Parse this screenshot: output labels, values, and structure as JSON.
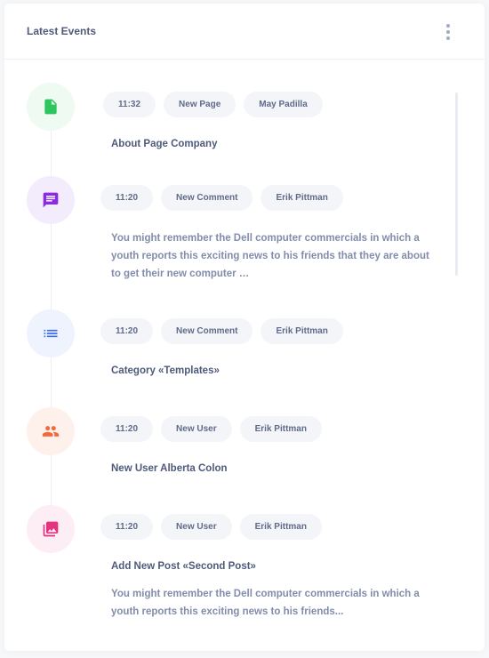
{
  "header": {
    "title": "Latest Events"
  },
  "events": [
    {
      "time": "11:32",
      "type": "New Page",
      "user": "May Padilla",
      "title": "About Page Company",
      "icon": "document-icon",
      "icon_color": "#2ec55c",
      "icon_bg": "#eefaf2"
    },
    {
      "time": "11:20",
      "type": "New Comment",
      "user": "Erik Pittman",
      "description": "You might remember the Dell computer commercials in which a youth reports this exciting news to his friends that they are about to get their new computer …",
      "icon": "comment-icon",
      "icon_color": "#8a2be2",
      "icon_bg": "#f3ecfd"
    },
    {
      "time": "11:20",
      "type": "New Comment",
      "user": "Erik Pittman",
      "title": "Category «Templates»",
      "icon": "list-icon",
      "icon_color": "#3b6bf0",
      "icon_bg": "#eef3fe"
    },
    {
      "time": "11:20",
      "type": "New User",
      "user": "Erik Pittman",
      "title": "New User Alberta Colon",
      "icon": "users-icon",
      "icon_color": "#f26a3a",
      "icon_bg": "#fef1ec"
    },
    {
      "time": "11:20",
      "type": "New User",
      "user": "Erik Pittman",
      "title": "Add New Post «Second Post»",
      "description": "You might remember the Dell computer commercials in which a youth reports this exciting news to his friends...",
      "icon": "photo-library-icon",
      "icon_color": "#e6337f",
      "icon_bg": "#fdeef5"
    }
  ]
}
